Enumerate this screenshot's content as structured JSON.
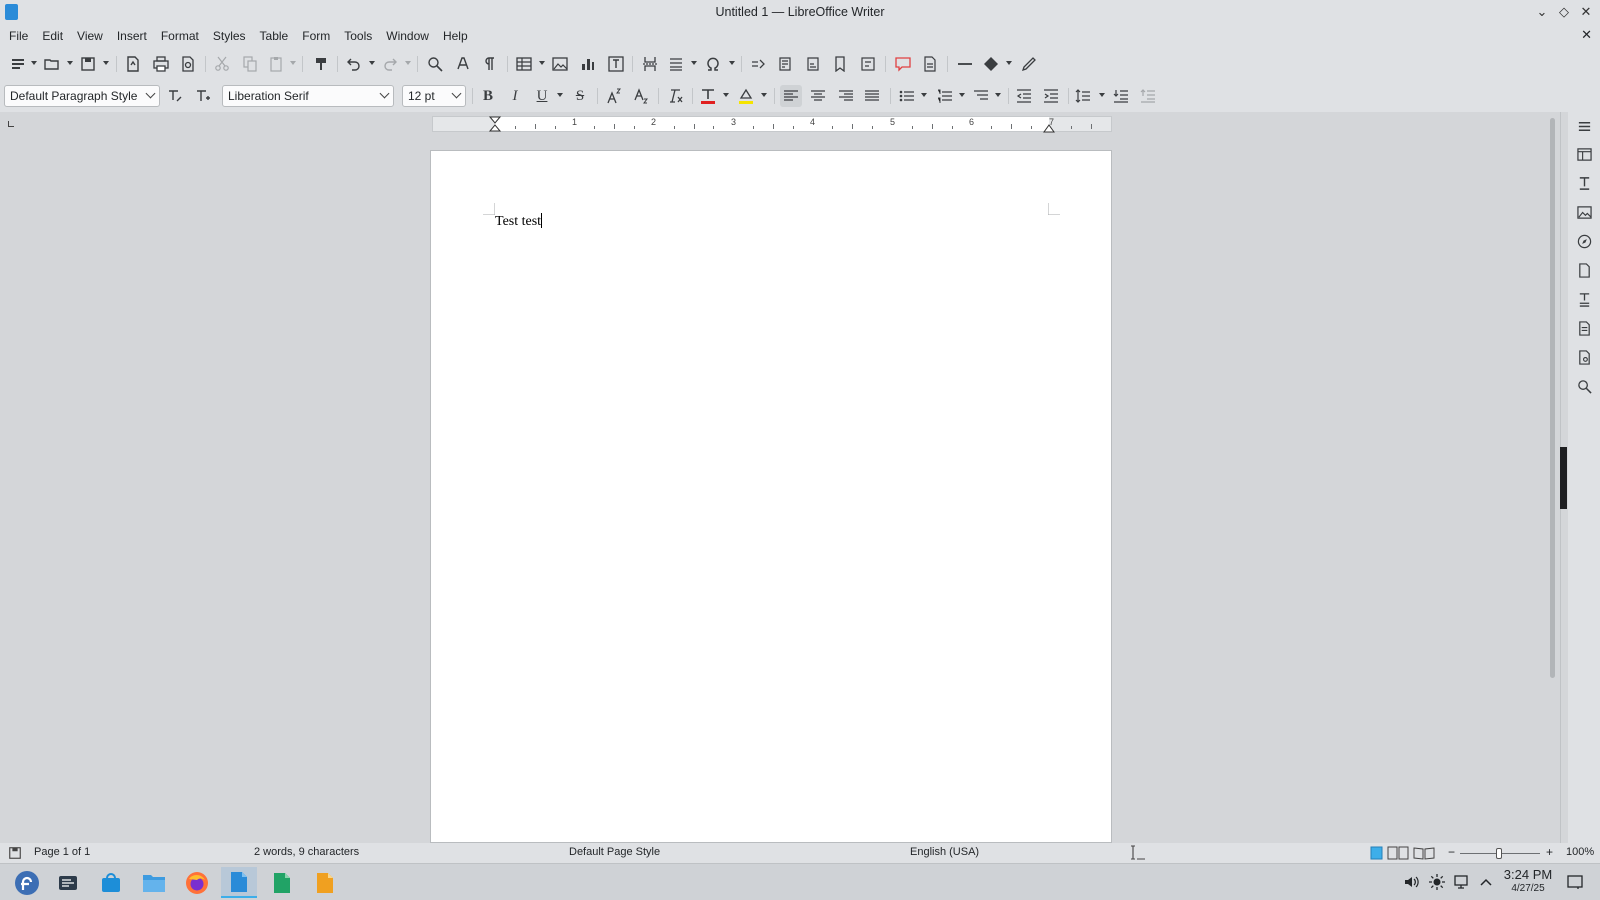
{
  "window": {
    "title": "Untitled 1 — LibreOffice Writer"
  },
  "menu": [
    "File",
    "Edit",
    "View",
    "Insert",
    "Format",
    "Styles",
    "Table",
    "Form",
    "Tools",
    "Window",
    "Help"
  ],
  "format_bar": {
    "paragraph_style": "Default Paragraph Style",
    "font_name": "Liberation Serif",
    "font_size": "12 pt",
    "bold_glyph": "B",
    "italic_glyph": "I",
    "underline_glyph": "U",
    "strike_glyph": "S"
  },
  "ruler": {
    "numbers": [
      "1",
      "2",
      "3",
      "4",
      "5",
      "6",
      "7"
    ]
  },
  "document": {
    "text": "Test test"
  },
  "status": {
    "page": "Page 1 of 1",
    "counts": "2 words, 9 characters",
    "page_style": "Default Page Style",
    "language": "English (USA)",
    "zoom": "100%",
    "zoom_minus": "−",
    "zoom_plus": "+"
  },
  "clock": {
    "time": "3:24 PM",
    "date": "4/27/25"
  },
  "colors": {
    "accent": "#3daee9",
    "font_color": "#e02020",
    "highlight": "#f5e400",
    "calc_green": "#21a366",
    "impress_orange": "#f0a020",
    "writer_blue": "#2a8bd8"
  }
}
